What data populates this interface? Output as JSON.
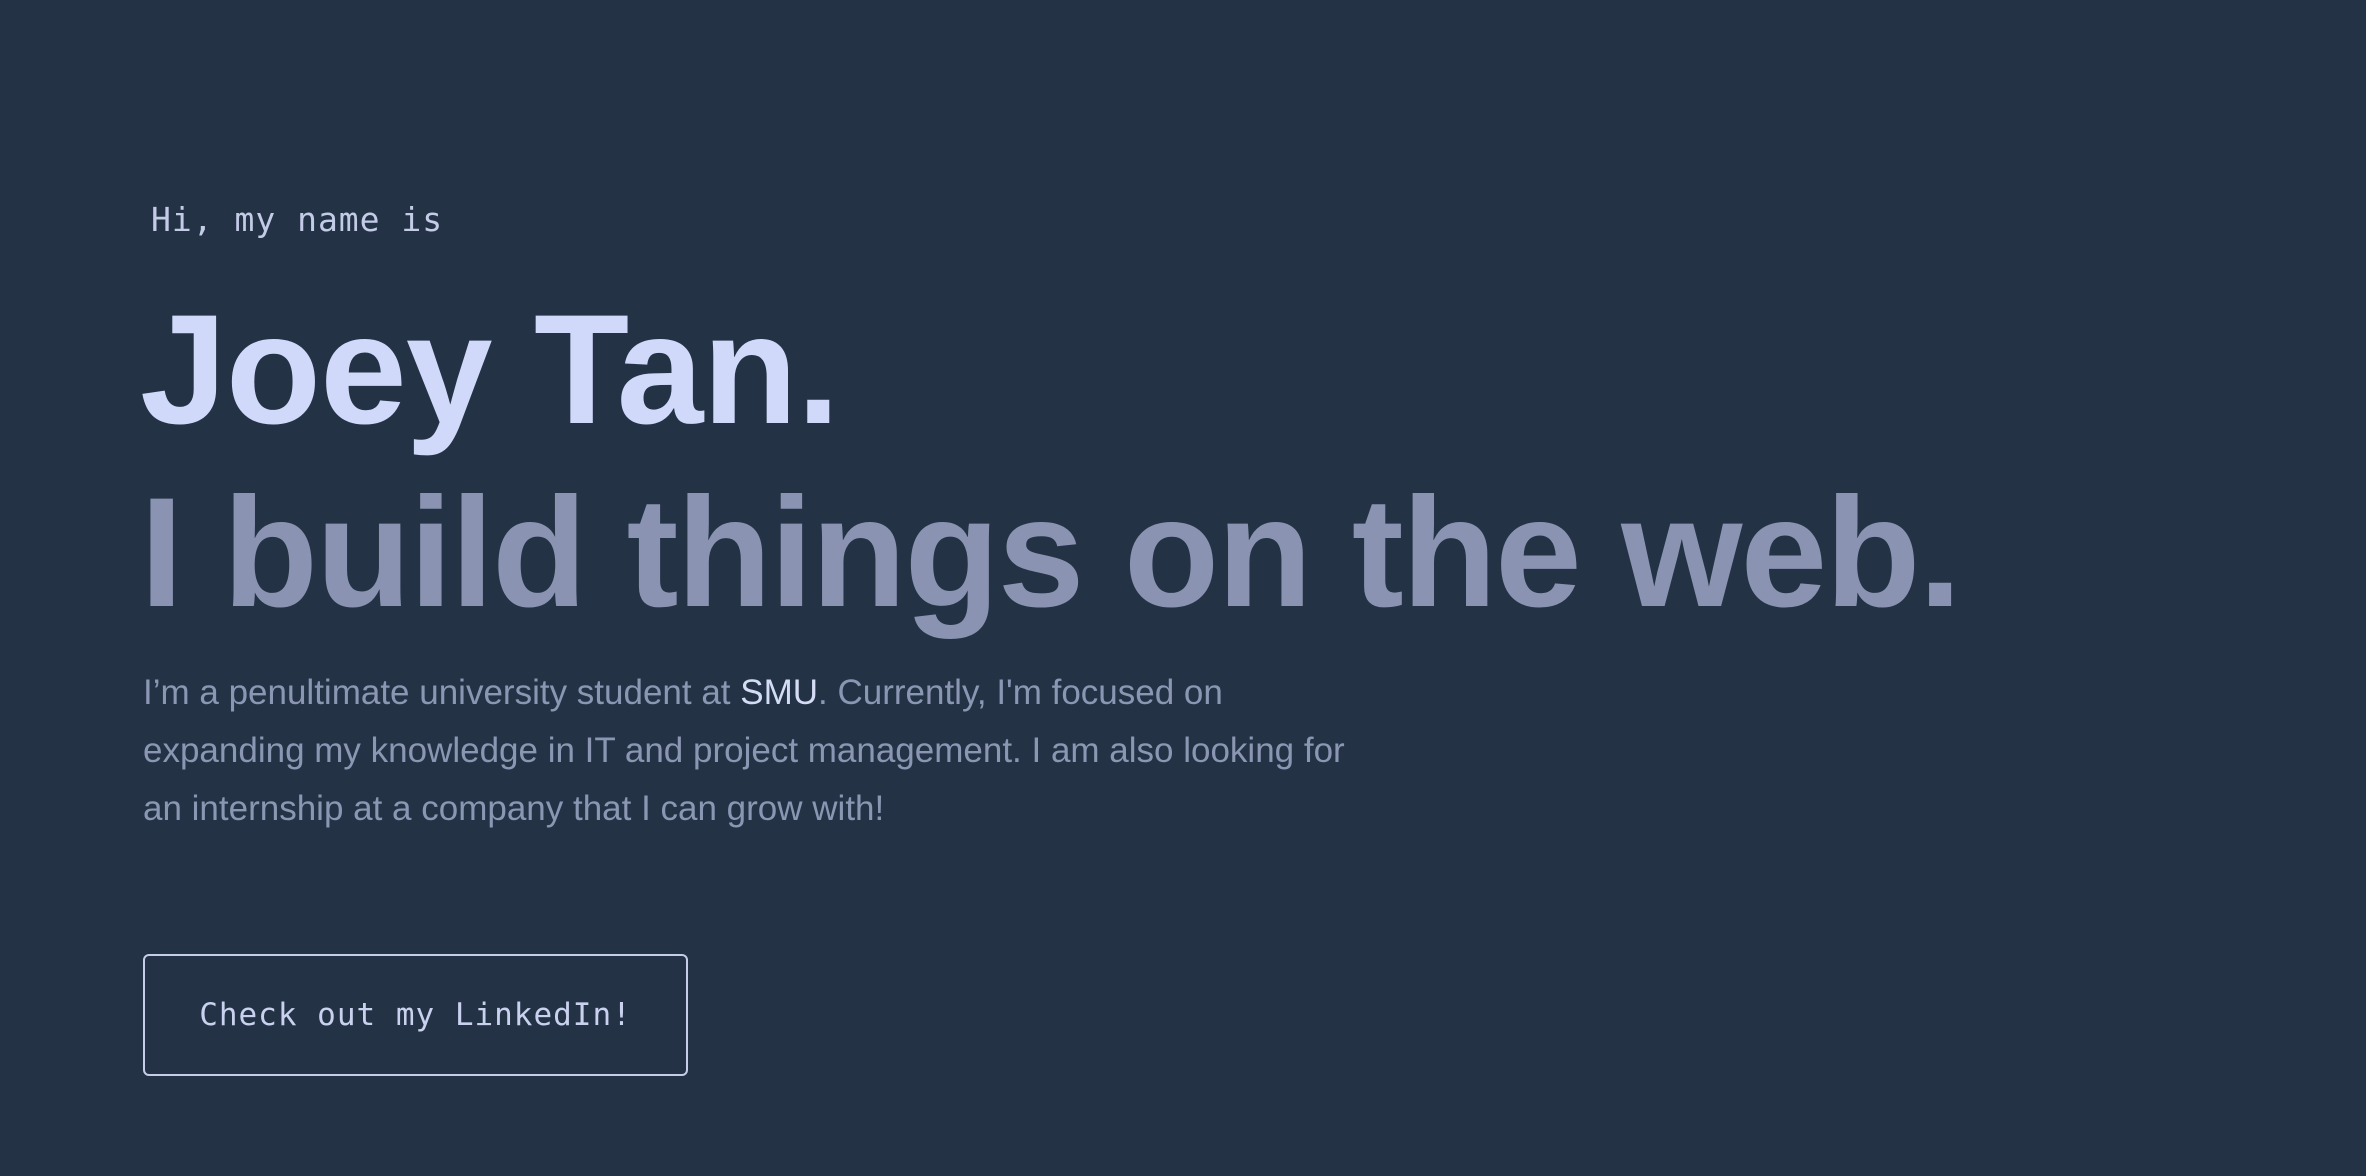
{
  "hero": {
    "intro": "Hi, my name is",
    "name": "Joey Tan.",
    "tagline": "I build things on the web.",
    "bio": {
      "before": "I’m a penultimate university student at ",
      "highlight": "SMU",
      "after": ". Currently, I'm focused on expanding my knowledge in IT and project management. I am also looking for an internship at a company that I can grow with!"
    },
    "cta_label": "Check out my LinkedIn!"
  },
  "colors": {
    "background": "#233345",
    "name": "#d0d9fa",
    "tagline": "#8a93b1",
    "body_text": "#8b96b3",
    "highlight": "#d4dcf5",
    "button_border": "#c6cde6"
  }
}
